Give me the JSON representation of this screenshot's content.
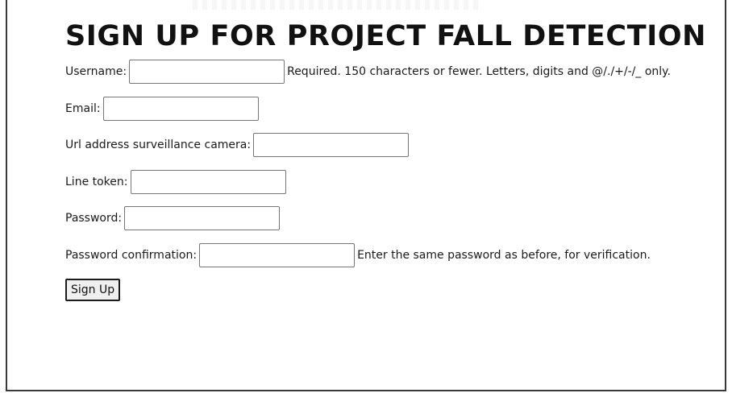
{
  "page": {
    "title": "SIGN UP FOR PROJECT FALL DETECTION"
  },
  "form": {
    "fields": [
      {
        "label": "Username:",
        "value": "",
        "help": "Required. 150 characters or fewer. Letters, digits and @/./+/-/_ only."
      },
      {
        "label": "Email:",
        "value": ""
      },
      {
        "label": "Url address surveillance camera:",
        "value": ""
      },
      {
        "label": "Line token:",
        "value": ""
      },
      {
        "label": "Password:",
        "value": ""
      },
      {
        "label": "Password confirmation:",
        "value": "",
        "help": "Enter the same password as before, for verification."
      }
    ],
    "submit_label": "Sign Up"
  }
}
